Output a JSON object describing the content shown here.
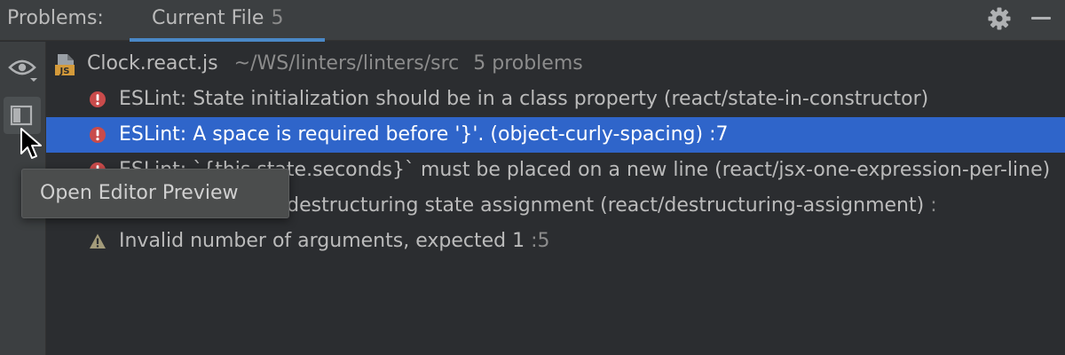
{
  "header": {
    "problems_label": "Problems:",
    "tab": {
      "label": "Current File",
      "count": "5"
    }
  },
  "toolbar": {
    "eye_icon": "eye-icon",
    "preview_icon": "editor-preview-icon"
  },
  "tooltip": {
    "text": "Open Editor Preview"
  },
  "file": {
    "name": "Clock.react.js",
    "path": "~/WS/linters/linters/src",
    "count": "5 problems",
    "icon": "js-file-icon"
  },
  "problems": [
    {
      "severity": "error",
      "text": "ESLint: State initialization should be in a class property (react/state-in-constructor)",
      "line": ""
    },
    {
      "severity": "error",
      "text": "ESLint: A space is required before '}'. (object-curly-spacing)",
      "line": ":7",
      "selected": true
    },
    {
      "severity": "error",
      "text": "ESLint: `{this.state.seconds}` must be placed on a new line (react/jsx-one-expression-per-line)",
      "line": ""
    },
    {
      "severity": "error",
      "text": "ESLint: Must use destructuring state assignment (react/destructuring-assignment)",
      "line": ":"
    },
    {
      "severity": "warning",
      "text": "Invalid number of arguments, expected 1",
      "line": ":5"
    }
  ],
  "colors": {
    "selection": "#2f65ca",
    "tab_underline": "#4a88c7",
    "error": "#c94b4b",
    "warning": "#a39b7a"
  }
}
